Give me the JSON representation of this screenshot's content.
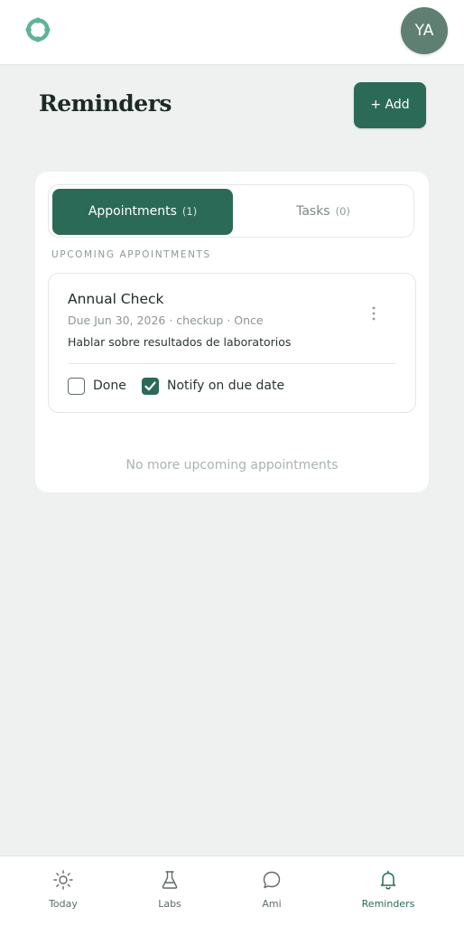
{
  "header": {
    "avatar_initials": "YA"
  },
  "page": {
    "title": "Reminders",
    "add_button_label": "+ Add"
  },
  "tabs": [
    {
      "label": "Appointments",
      "count": "(1)",
      "active": true
    },
    {
      "label": "Tasks",
      "count": "(0)",
      "active": false
    }
  ],
  "section_label": "UPCOMING APPOINTMENTS",
  "appointments": [
    {
      "title": "Annual Check",
      "meta": "Due Jun 30, 2026 · checkup · Once",
      "note": "Hablar sobre resultados de laboratorios",
      "done_label": "Done",
      "done_checked": false,
      "notify_label": "Notify on due date",
      "notify_checked": true
    }
  ],
  "empty_message": "No more upcoming appointments",
  "bottom_nav": [
    {
      "label": "Today",
      "icon": "sun-icon",
      "active": false
    },
    {
      "label": "Labs",
      "icon": "flask-icon",
      "active": false
    },
    {
      "label": "Ami",
      "icon": "chat-bubble-icon",
      "active": false
    },
    {
      "label": "Reminders",
      "icon": "bell-icon",
      "active": true
    }
  ],
  "colors": {
    "accent": "#2b6a56",
    "background": "#eef1f0",
    "avatar": "#5f7f72"
  }
}
